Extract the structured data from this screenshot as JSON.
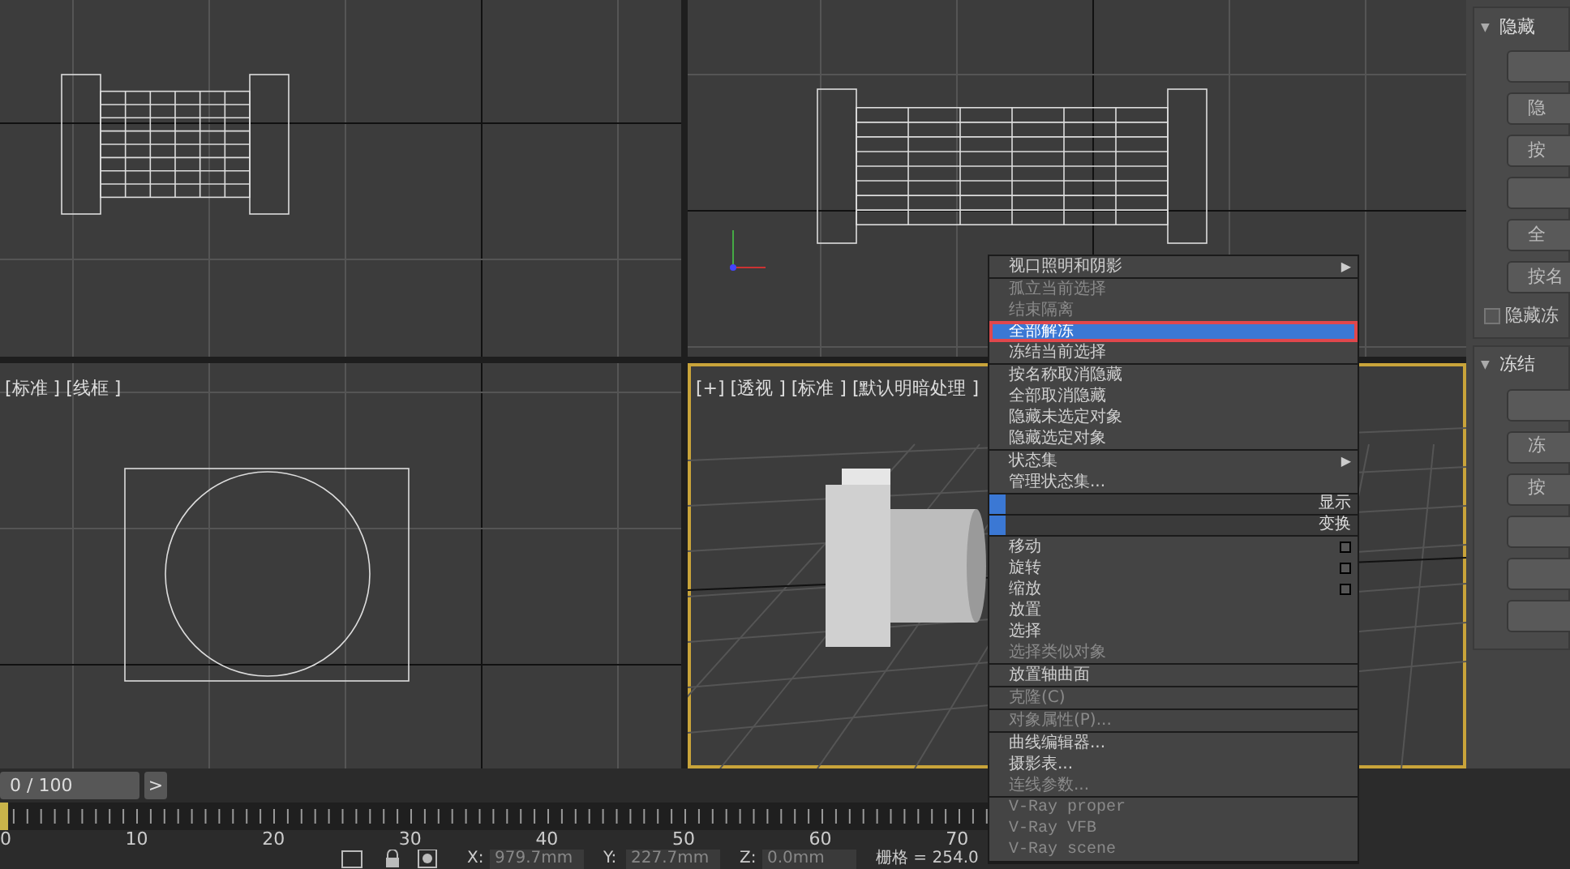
{
  "viewports": [
    {
      "kind": "front",
      "selected": false
    },
    {
      "kind": "top-right",
      "selected": false
    },
    {
      "label": "[标准 ] [线框 ]",
      "kind": "left",
      "selected": false
    },
    {
      "label": "[+] [透视 ] [标准 ] [默认明暗处理 ]",
      "kind": "perspective",
      "selected": true
    }
  ],
  "quad_menu": {
    "groups": [
      [
        {
          "label": "视口照明和阴影",
          "arrow": "▶",
          "disabled": false,
          "selected": false
        }
      ],
      [
        {
          "label": "孤立当前选择",
          "disabled": true,
          "selected": false
        },
        {
          "label": "结束隔离",
          "disabled": true,
          "selected": false
        },
        {
          "label": "全部解冻",
          "disabled": false,
          "selected": true
        },
        {
          "label": "冻结当前选择",
          "disabled": false,
          "selected": false
        }
      ],
      [
        {
          "label": "按名称取消隐藏",
          "disabled": false,
          "selected": false
        },
        {
          "label": "全部取消隐藏",
          "disabled": false,
          "selected": false
        },
        {
          "label": "隐藏未选定对象",
          "disabled": false,
          "selected": false
        },
        {
          "label": "隐藏选定对象",
          "disabled": false,
          "selected": false
        }
      ],
      [
        {
          "label": "状态集",
          "arrow": "▶",
          "disabled": false,
          "selected": false
        },
        {
          "label": "管理状态集...",
          "disabled": false,
          "selected": false
        }
      ],
      [
        {
          "label": "显示",
          "kind": "bar"
        }
      ],
      [
        {
          "label": "变换",
          "kind": "bar"
        }
      ],
      [
        {
          "label": "移动",
          "box": true,
          "disabled": false,
          "selected": false
        },
        {
          "label": "旋转",
          "box": true,
          "disabled": false,
          "selected": false
        },
        {
          "label": "缩放",
          "box": true,
          "disabled": false,
          "selected": false
        },
        {
          "label": "放置",
          "disabled": false,
          "selected": false
        },
        {
          "label": "选择",
          "disabled": false,
          "selected": false
        },
        {
          "label": "选择类似对象",
          "disabled": true,
          "selected": false
        }
      ],
      [
        {
          "label": "放置轴曲面",
          "disabled": false,
          "selected": false
        }
      ],
      [
        {
          "label": "克隆(C)",
          "disabled": true,
          "selected": false
        }
      ],
      [
        {
          "label": "对象属性(P)...",
          "disabled": true,
          "selected": false
        }
      ],
      [
        {
          "label": "曲线编辑器...",
          "disabled": false,
          "selected": false
        },
        {
          "label": "摄影表...",
          "disabled": false,
          "selected": false
        },
        {
          "label": "连线参数...",
          "disabled": true,
          "selected": false
        }
      ],
      [
        {
          "label": "V-Ray proper",
          "kind": "code",
          "disabled": true,
          "selected": false
        },
        {
          "label": "V-Ray VFB",
          "kind": "code",
          "disabled": true,
          "selected": false
        },
        {
          "label": "V-Ray scene",
          "kind": "code",
          "disabled": true,
          "selected": false
        }
      ]
    ]
  },
  "command_panel": {
    "sections": [
      {
        "toggle": "▼",
        "title": "隐藏",
        "expanded": true,
        "buttons": [
          {
            "kind": "blank"
          },
          {
            "kind": "text",
            "label": "隐"
          },
          {
            "kind": "text",
            "label": "按"
          },
          {
            "kind": "blank"
          },
          {
            "kind": "text",
            "label": "全"
          },
          {
            "kind": "text",
            "label": "按名"
          }
        ],
        "checkbox": {
          "label": "隐藏冻",
          "checked": false
        }
      },
      {
        "toggle": "▼",
        "title": "冻结",
        "expanded": true,
        "buttons": [
          {
            "kind": "blank"
          },
          {
            "kind": "text",
            "label": "冻"
          },
          {
            "kind": "text",
            "label": "按"
          },
          {
            "kind": "blank"
          },
          {
            "kind": "blank"
          },
          {
            "kind": "blank"
          }
        ]
      }
    ]
  },
  "timeline": {
    "frame": "0 / 100",
    "next": ">",
    "slider": {
      "level": 0
    },
    "ticks": [
      "0",
      "10",
      "20",
      "30",
      "40",
      "50",
      "60",
      "70"
    ]
  },
  "status_bar": {
    "x_label": "X:",
    "x": "979.7mm",
    "y_label": "Y:",
    "y": "227.7mm",
    "z_label": "Z:",
    "z": "0.0mm",
    "grid": "栅格 = 254.0"
  }
}
